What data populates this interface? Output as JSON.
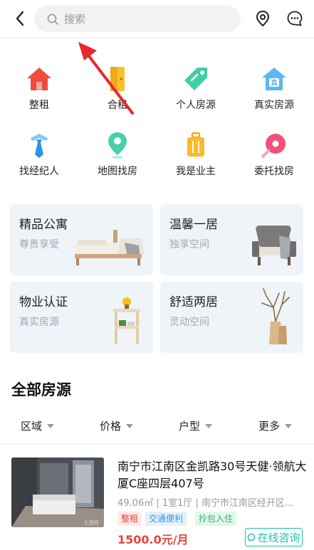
{
  "header": {
    "search_placeholder": "搜索"
  },
  "categories": [
    {
      "label": "整租",
      "icon": "house-icon"
    },
    {
      "label": "合租",
      "icon": "door-icon"
    },
    {
      "label": "个人房源",
      "icon": "tag-icon"
    },
    {
      "label": "真实房源",
      "icon": "verified-house-icon"
    },
    {
      "label": "找经纪人",
      "icon": "agent-tie-icon"
    },
    {
      "label": "地图找房",
      "icon": "map-pin-icon"
    },
    {
      "label": "我是业主",
      "icon": "suitcase-icon"
    },
    {
      "label": "委托找房",
      "icon": "entrust-icon"
    }
  ],
  "cards": [
    {
      "title": "精品公寓",
      "subtitle": "尊贵享受"
    },
    {
      "title": "温馨一居",
      "subtitle": "独享空间"
    },
    {
      "title": "物业认证",
      "subtitle": "真实房源"
    },
    {
      "title": "舒适两居",
      "subtitle": "灵动空间"
    }
  ],
  "section": {
    "title": "全部房源"
  },
  "filters": [
    "区域",
    "价格",
    "户型",
    "更多"
  ],
  "listing": {
    "title": "南宁市江南区金凯路30号天健·领航大厦C座四层407号",
    "meta": "49.06㎡ | 1室1厅 | 南宁市江南区经开区...",
    "tags": [
      "整租",
      "交通便利",
      "拎包入住"
    ],
    "price": "1500.0元/月",
    "consult_label": "在线咨询"
  },
  "colors": {
    "accent": "#1fbfb4",
    "price": "#e8453c",
    "card_bg": "#eef4f8"
  }
}
